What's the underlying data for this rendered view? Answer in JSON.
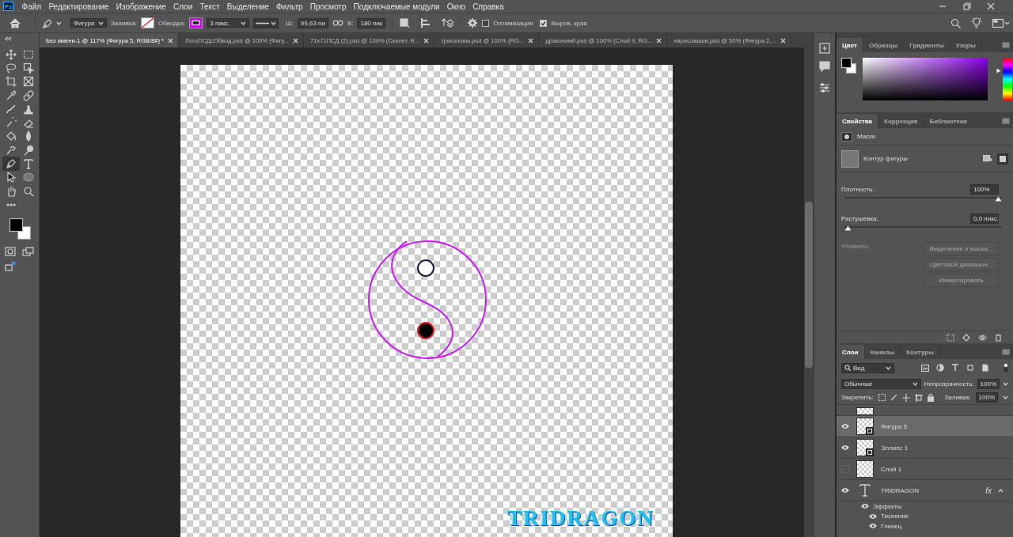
{
  "app": {
    "logo": "Ps"
  },
  "menu": [
    "Файл",
    "Редактирование",
    "Изображение",
    "Слои",
    "Текст",
    "Выделение",
    "Фильтр",
    "Просмотр",
    "Подключаемые модули",
    "Окно",
    "Справка"
  ],
  "options_bar": {
    "tool_mode": "Фигура",
    "fill_label": "Заливка:",
    "stroke_label": "Обводка:",
    "stroke_width": "3 пикс.",
    "width_label": "Ш:",
    "width_value": "99,63 пи",
    "height_label": "В:",
    "height_value": "180 пик",
    "checkboxes": [
      {
        "label": "Оптимизация",
        "checked": false
      },
      {
        "label": "Выров. края",
        "checked": true
      }
    ]
  },
  "document_tabs": [
    {
      "label": "Без имени-1 @ 117% (Фигура 5, RGB/8#) *",
      "selected": true
    },
    {
      "label": "ЛогоПСДсОбвод.psd @ 100% (Фигу...",
      "selected": false
    },
    {
      "label": "71x71ПСД (2).psd @ 100% (Скелет, R...",
      "selected": false
    },
    {
      "label": "триголовы.psd @ 100% (RG...",
      "selected": false
    },
    {
      "label": "драконэмб.psd @ 100% (Слой 9, RG...",
      "selected": false
    },
    {
      "label": "нарисоваши.psd @ 50% (Фигура 2,...",
      "selected": false
    }
  ],
  "tools": [
    {
      "kind": "move",
      "selected": false
    },
    {
      "kind": "marquee",
      "selected": false
    },
    {
      "kind": "lasso",
      "selected": false
    },
    {
      "kind": "selection",
      "selected": false
    },
    {
      "kind": "crop",
      "selected": false
    },
    {
      "kind": "frame",
      "selected": false
    },
    {
      "kind": "eyedropper",
      "selected": false
    },
    {
      "kind": "bandage",
      "selected": false
    },
    {
      "kind": "brush",
      "selected": false
    },
    {
      "kind": "stamp",
      "selected": false
    },
    {
      "kind": "history-brush",
      "selected": false
    },
    {
      "kind": "eraser",
      "selected": false
    },
    {
      "kind": "bucket",
      "selected": false
    },
    {
      "kind": "drop",
      "selected": false
    },
    {
      "kind": "smudge",
      "selected": false
    },
    {
      "kind": "dodge",
      "selected": false
    },
    {
      "kind": "pen",
      "selected": true
    },
    {
      "kind": "type",
      "selected": false
    },
    {
      "kind": "pointer",
      "selected": false
    },
    {
      "kind": "ellipse",
      "selected": false
    },
    {
      "kind": "hand",
      "selected": false
    },
    {
      "kind": "zoom",
      "selected": false
    },
    {
      "kind": "more",
      "selected": false
    }
  ],
  "canvas": {
    "text": "TRIDRAGON"
  },
  "color_panel": {
    "hue_slider": {
      "level": 0.72
    },
    "tabs": [
      {
        "label": "Цвет",
        "selected": true
      },
      {
        "label": "Образцы",
        "selected": false
      },
      {
        "label": "Градиенты",
        "selected": false
      },
      {
        "label": "Узоры",
        "selected": false
      }
    ]
  },
  "properties_panel": {
    "tabs": [
      {
        "label": "Свойства",
        "selected": true
      },
      {
        "label": "Коррекция",
        "selected": false
      },
      {
        "label": "Библиотеки",
        "selected": false
      }
    ],
    "section": "Маски",
    "mask_name": "Контур фигуры",
    "sliders": [
      {
        "label": "Плотность:",
        "value": "100%",
        "level": 1
      },
      {
        "label": "Растушевка:",
        "value": "0,0 пикс.",
        "level": 0
      }
    ],
    "refine_label": "Уточнить:",
    "buttons": [
      {
        "label": "Выделение и маска...",
        "disabled": true
      },
      {
        "label": "Цветовой диапазон...",
        "disabled": true
      },
      {
        "label": "Инвертировать",
        "disabled": true
      }
    ]
  },
  "layers_panel": {
    "tabs": [
      {
        "label": "Слои",
        "selected": true
      },
      {
        "label": "Каналы",
        "selected": false
      },
      {
        "label": "Контуры",
        "selected": false
      }
    ],
    "filter": "Вид",
    "blend_mode": "Обычные",
    "opacity_label": "Непрозрачность:",
    "opacity": "100%",
    "lock_label": "Закрепить:",
    "fill_label": "Заливка:",
    "fill": "100%",
    "layers": [
      {
        "name": "Фигура 5",
        "kind": "shape",
        "visible": true,
        "selected": true
      },
      {
        "name": "Эллипс 1",
        "kind": "shape",
        "visible": true,
        "selected": false
      },
      {
        "name": "Слой 1",
        "kind": "pixel",
        "visible": false,
        "selected": false
      },
      {
        "name": "TRIDRAGON",
        "kind": "text",
        "visible": true,
        "selected": false,
        "fx": "fx",
        "children": [
          {
            "name": "Эффекты",
            "visible": true,
            "children": [
              {
                "name": "Тиснение",
                "visible": true
              },
              {
                "name": "Глянец",
                "visible": true
              }
            ]
          }
        ]
      }
    ]
  }
}
